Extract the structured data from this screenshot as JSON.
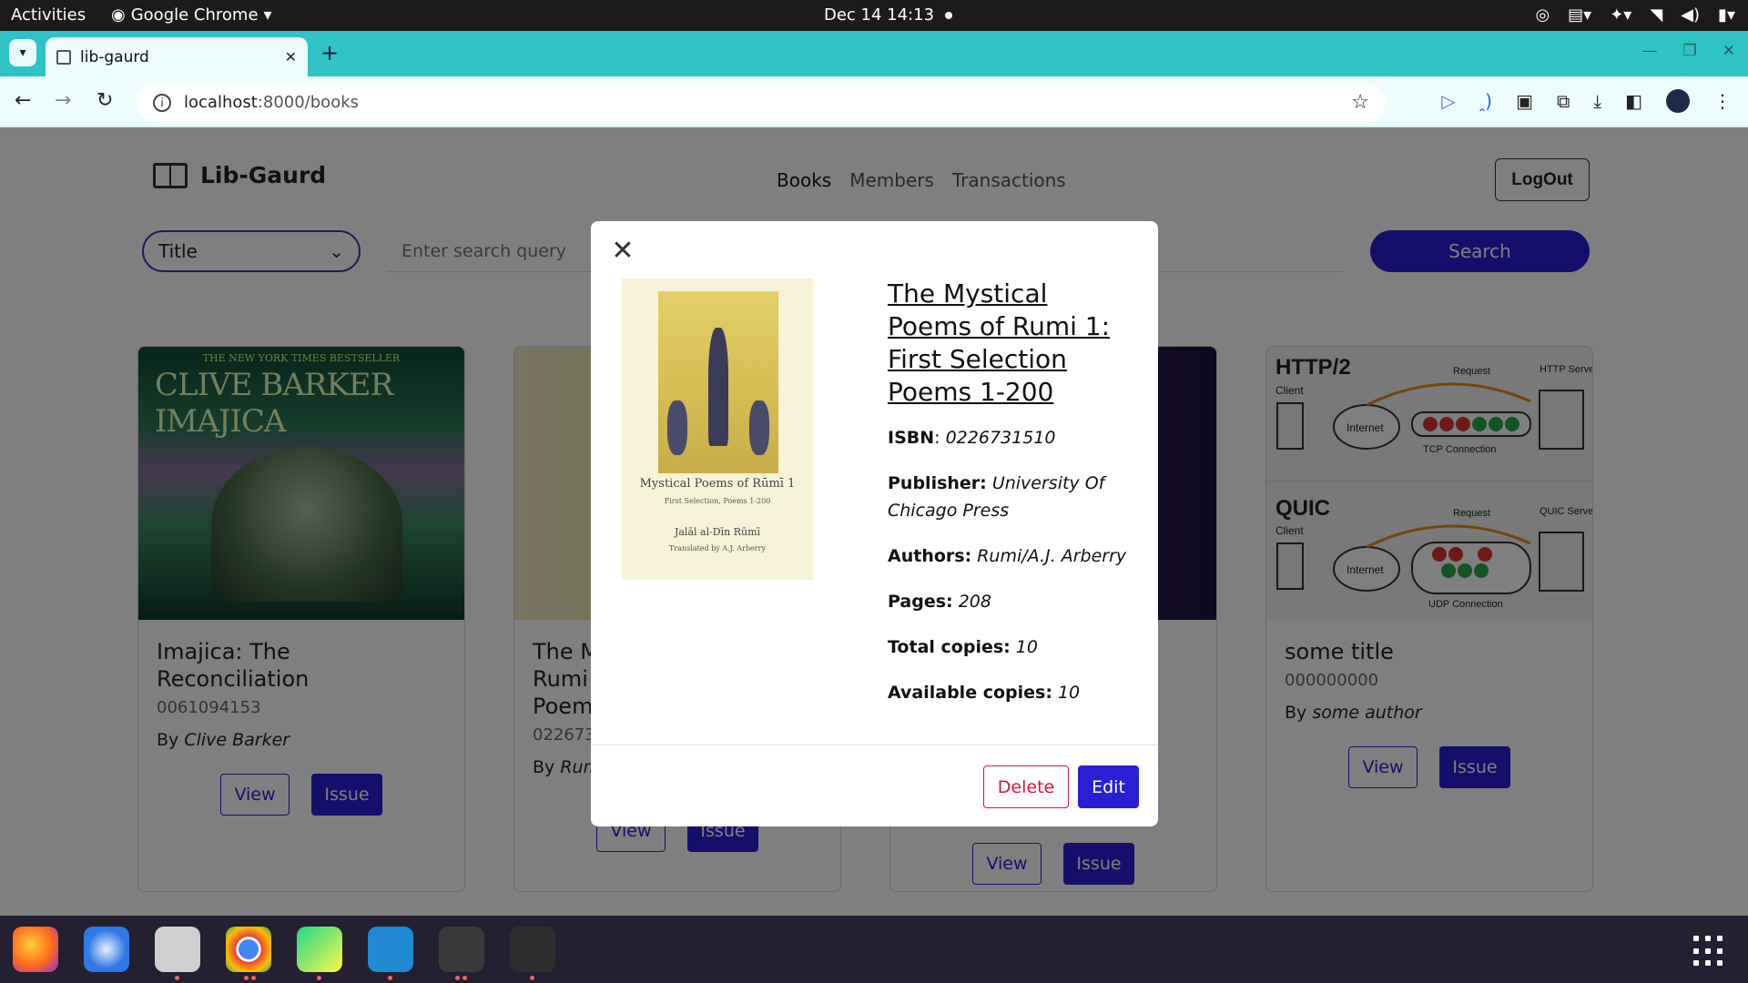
{
  "system_bar": {
    "activities": "Activities",
    "app_name": "Google Chrome",
    "clock": "Dec 14  14:13"
  },
  "browser": {
    "tab_title": "lib-gaurd",
    "url_host": "localhost",
    "url_path": ":8000/books"
  },
  "header": {
    "brand": "Lib-Gaurd",
    "nav": [
      "Books",
      "Members",
      "Transactions"
    ],
    "logout": "LogOut"
  },
  "search": {
    "field_selected": "Title",
    "placeholder": "Enter search query",
    "button": "Search"
  },
  "cards": [
    {
      "title": "Imajica: The Reconciliation",
      "isbn": "0061094153",
      "by": "By",
      "author": "Clive Barker",
      "view": "View",
      "issue": "Issue",
      "cover_text": "CLIVE BARKER IMAJICA",
      "cover_header": "THE NEW YORK TIMES BESTSELLER"
    },
    {
      "title": "The M\nRumi\nPoem",
      "isbn": "022673",
      "by": "By",
      "author": "Rum",
      "view": "View",
      "issue": "Issue"
    },
    {
      "title": "",
      "isbn": "",
      "by": "",
      "author": "",
      "view": "View",
      "issue": "Issue"
    },
    {
      "title": "some title",
      "isbn": "000000000",
      "by": "By",
      "author": "some author",
      "view": "View",
      "issue": "Issue"
    }
  ],
  "diagram": {
    "http2_label": "HTTP/2",
    "quic_label": "QUIC",
    "client": "Client",
    "internet": "Internet",
    "request": "Request",
    "http_server": "HTTP Server",
    "quic_server": "QUIC Server",
    "tcp": "TCP Connection",
    "udp": "UDP Connection"
  },
  "modal": {
    "title": "The Mystical Poems of Rumi 1: First Selection Poems 1-200",
    "isbn_label": "ISBN",
    "isbn": "0226731510",
    "publisher_label": "Publisher:",
    "publisher": "University Of Chicago Press",
    "authors_label": "Authors:",
    "authors": "Rumi/A.J. Arberry",
    "pages_label": "Pages:",
    "pages": "208",
    "total_label": "Total copies:",
    "total": "10",
    "available_label": "Available copies:",
    "available": "10",
    "delete": "Delete",
    "edit": "Edit",
    "cover": {
      "title": "Mystical Poems of Rūmī 1",
      "subtitle": "First Selection, Poems 1-200",
      "author": "Jalāl al-Dīn Rūmī",
      "translator": "Translated by A.J. Arberry"
    }
  },
  "colors": {
    "primary": "#2b1fd6",
    "danger": "#dc143c",
    "tab_strip": "#2fc3c5"
  }
}
